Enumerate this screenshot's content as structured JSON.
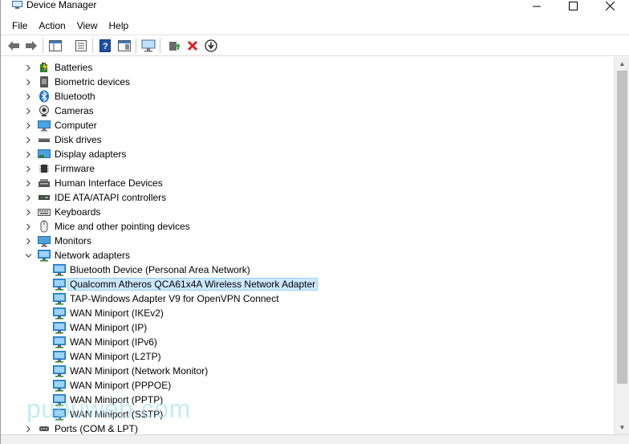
{
  "window": {
    "title": "Device Manager"
  },
  "menu": [
    "File",
    "Action",
    "View",
    "Help"
  ],
  "toolbar": {
    "buttons": [
      "back-icon",
      "forward-icon",
      "properties-panel-icon",
      "list-view-icon",
      "help-icon",
      "action-pane-icon",
      "monitor-icon",
      "update-driver-icon",
      "uninstall-icon",
      "disable-device-icon"
    ]
  },
  "tree": {
    "categories": [
      {
        "label": "Batteries",
        "icon": "battery-icon",
        "expanded": false
      },
      {
        "label": "Biometric devices",
        "icon": "biometric-icon",
        "expanded": false
      },
      {
        "label": "Bluetooth",
        "icon": "bluetooth-icon",
        "expanded": false
      },
      {
        "label": "Cameras",
        "icon": "camera-icon",
        "expanded": false
      },
      {
        "label": "Computer",
        "icon": "computer-icon",
        "expanded": false
      },
      {
        "label": "Disk drives",
        "icon": "disk-drive-icon",
        "expanded": false
      },
      {
        "label": "Display adapters",
        "icon": "display-adapter-icon",
        "expanded": false
      },
      {
        "label": "Firmware",
        "icon": "firmware-icon",
        "expanded": false
      },
      {
        "label": "Human Interface Devices",
        "icon": "hid-icon",
        "expanded": false
      },
      {
        "label": "IDE ATA/ATAPI controllers",
        "icon": "ide-controller-icon",
        "expanded": false
      },
      {
        "label": "Keyboards",
        "icon": "keyboard-icon",
        "expanded": false
      },
      {
        "label": "Mice and other pointing devices",
        "icon": "mouse-icon",
        "expanded": false
      },
      {
        "label": "Monitors",
        "icon": "monitor-icon",
        "expanded": false
      },
      {
        "label": "Network adapters",
        "icon": "network-adapter-icon",
        "expanded": true
      }
    ],
    "network_adapters": [
      {
        "label": "Bluetooth Device (Personal Area Network)",
        "selected": false
      },
      {
        "label": "Qualcomm Atheros QCA61x4A Wireless Network Adapter",
        "selected": true
      },
      {
        "label": "TAP-Windows Adapter V9 for OpenVPN Connect",
        "selected": false
      },
      {
        "label": "WAN Miniport (IKEv2)",
        "selected": false
      },
      {
        "label": "WAN Miniport (IP)",
        "selected": false
      },
      {
        "label": "WAN Miniport (IPv6)",
        "selected": false
      },
      {
        "label": "WAN Miniport (L2TP)",
        "selected": false
      },
      {
        "label": "WAN Miniport (Network Monitor)",
        "selected": false
      },
      {
        "label": "WAN Miniport (PPPOE)",
        "selected": false
      },
      {
        "label": "WAN Miniport (PPTP)",
        "selected": false
      },
      {
        "label": "WAN Miniport (SSTP)",
        "selected": false
      }
    ],
    "after": [
      {
        "label": "Ports (COM & LPT)",
        "icon": "port-icon",
        "expanded": false
      }
    ]
  },
  "watermark": "pupuweb.com",
  "colors": {
    "selection_bg": "#cce8ff",
    "selection_border": "#99d1ff",
    "adapter_icon": "#1e7fd0"
  }
}
